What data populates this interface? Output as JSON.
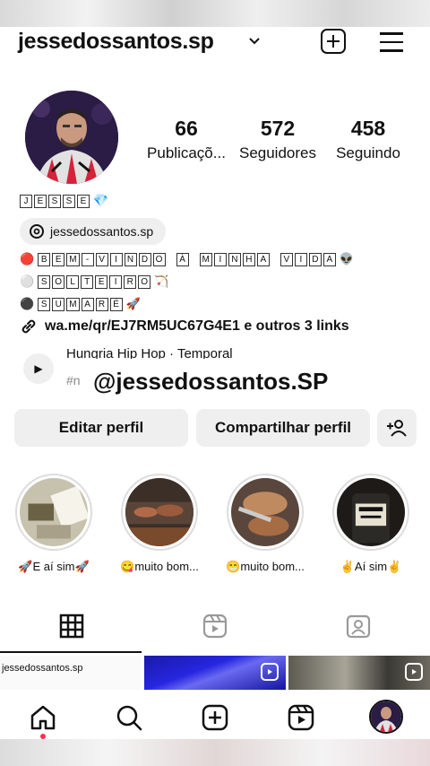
{
  "profile": {
    "username": "jessedossantos.sp",
    "name_chars": [
      "J",
      "E",
      "S",
      "S",
      "E"
    ],
    "threads_handle": "jessedossantos.sp",
    "bio_line1_chars": [
      "B",
      "E",
      "M",
      "-",
      "V",
      "I",
      "N",
      "D",
      "O",
      " ",
      "À",
      " ",
      "M",
      "I",
      "N",
      "H",
      "A",
      " ",
      "V",
      "I",
      "D",
      "A"
    ],
    "bio_line2_chars": [
      "S",
      "O",
      "L",
      "T",
      "E",
      "I",
      "R",
      "O"
    ],
    "bio_line3_chars": [
      "S",
      "U",
      "M",
      "A",
      "R",
      "É"
    ],
    "link_text": "wa.me/qr/EJ7RM5UC67G4E1 e outros 3 links",
    "music_title": "Hungria Hip Hop · Temporal",
    "music_sub": "#n",
    "overlay_handle": "@jessedossantos.SP"
  },
  "stats": [
    {
      "number": "66",
      "label": "Publicaçõ..."
    },
    {
      "number": "572",
      "label": "Seguidores"
    },
    {
      "number": "458",
      "label": "Seguindo"
    }
  ],
  "buttons": {
    "edit": "Editar perfil",
    "share": "Compartilhar perfil"
  },
  "stories": [
    {
      "label": "🚀E aí sim🚀"
    },
    {
      "label": "😋muito bom..."
    },
    {
      "label": "😁muito bom..."
    },
    {
      "label": "✌️Aí sim✌️"
    }
  ],
  "grid": {
    "first_caption": "jessedossantos.sp"
  },
  "colors": {
    "background": "#ffffff",
    "text": "#111111",
    "button_bg": "#efefef",
    "muted": "#888888"
  },
  "icons": [
    "chevron-down-icon",
    "new-post-icon",
    "menu-icon",
    "threads-icon",
    "link-icon",
    "play-icon",
    "add-person-icon",
    "grid-icon",
    "reels-icon",
    "tagged-icon",
    "home-icon",
    "search-icon",
    "create-icon",
    "reels-nav-icon",
    "profile-avatar"
  ]
}
